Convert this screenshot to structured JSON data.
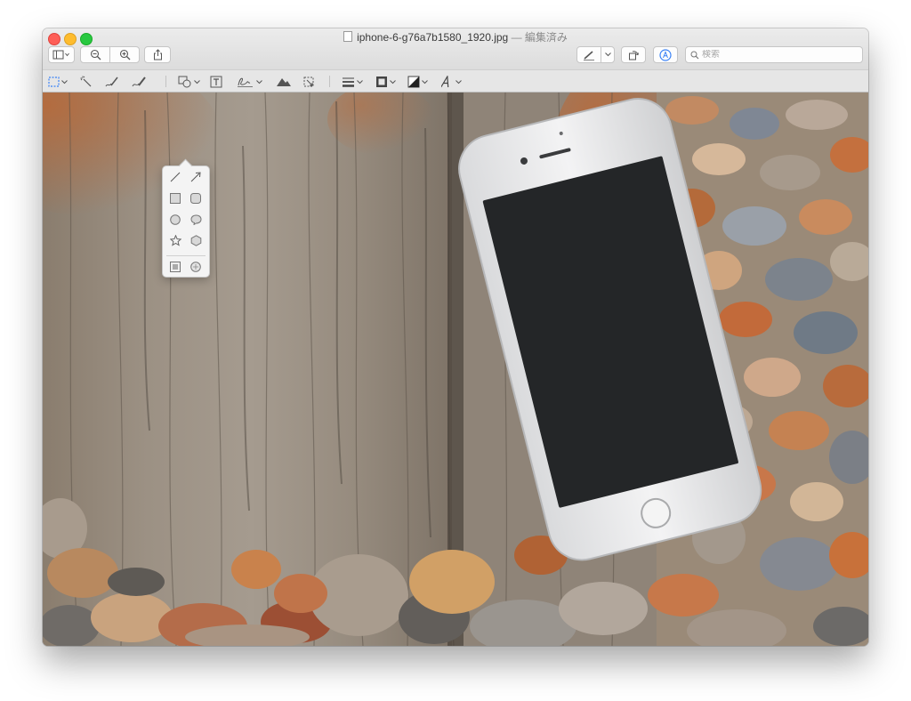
{
  "window": {
    "title": "iphone-6-g76a7b1580_1920.jpg",
    "title_status": " — 編集済み"
  },
  "search": {
    "placeholder": "検索",
    "value": ""
  },
  "toolbar": {
    "items": [
      "sidebar-toggle",
      "zoom-out",
      "zoom-in",
      "share",
      "markup-pen",
      "rotate",
      "markup-toolbar-toggle"
    ]
  },
  "markup_toolbar": {
    "items": [
      "rectangular-selection",
      "instant-alpha",
      "sketch",
      "draw",
      "shapes",
      "text",
      "sign",
      "adjust-color",
      "adjust-size",
      "shape-style",
      "border-color",
      "fill-color",
      "text-style"
    ]
  },
  "shapes_popover": {
    "items": [
      "line",
      "arrow",
      "rectangle",
      "rounded-rectangle",
      "oval",
      "speech-bubble",
      "star",
      "polygon",
      "mask",
      "loupe"
    ]
  },
  "colors": {
    "accent": "#3b82f6",
    "close": "#fe5f57",
    "minimize": "#febc2e",
    "maximize": "#28c840"
  }
}
